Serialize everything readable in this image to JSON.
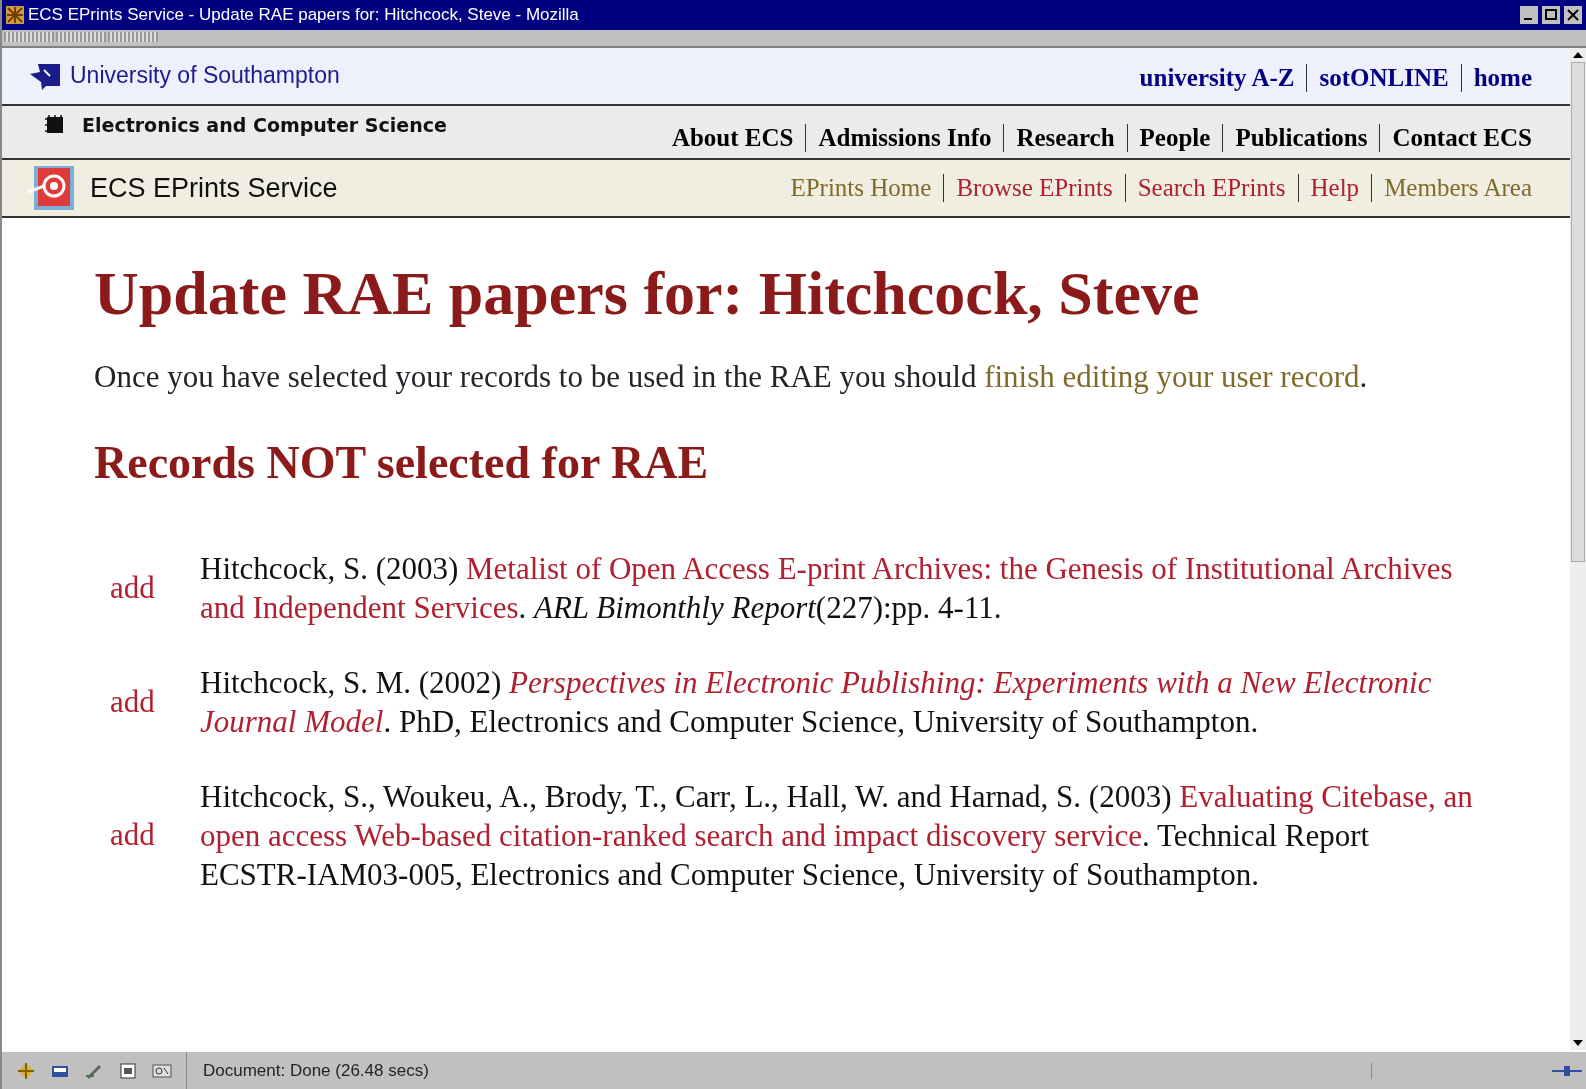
{
  "window": {
    "title": "ECS EPrints Service - Update RAE papers for: Hitchcock, Steve - Mozilla"
  },
  "university_bar": {
    "name": "University of Southampton",
    "links": [
      "university A-Z",
      "sotONLINE",
      "home"
    ]
  },
  "school_bar": {
    "name": "Electronics and Computer Science",
    "links": [
      "About ECS",
      "Admissions Info",
      "Research",
      "People",
      "Publications",
      "Contact ECS"
    ]
  },
  "eprints_bar": {
    "name": "ECS EPrints Service",
    "links": [
      {
        "label": "EPrints Home",
        "visited": true
      },
      {
        "label": "Browse EPrints",
        "visited": false
      },
      {
        "label": "Search EPrints",
        "visited": false
      },
      {
        "label": "Help",
        "visited": false
      },
      {
        "label": "Members Area",
        "visited": true
      }
    ]
  },
  "heading": "Update RAE papers for: Hitchcock, Steve",
  "intro": {
    "text": "Once you have selected your records to be used in the RAE you should",
    "link": "finish editing your user record",
    "after": "."
  },
  "section_heading": "Records NOT selected for RAE",
  "records": [
    {
      "action": "add",
      "parts": [
        {
          "kind": "plain",
          "text": "Hitchcock, S. (2003) "
        },
        {
          "kind": "link",
          "text": "Metalist of Open Access E-print Archives: the Genesis of Institutional Archives and Independent Services"
        },
        {
          "kind": "plain",
          "text": ". "
        },
        {
          "kind": "italic",
          "text": "ARL Bimonthly Report"
        },
        {
          "kind": "plain",
          "text": "(227):pp. 4-11."
        }
      ]
    },
    {
      "action": "add",
      "parts": [
        {
          "kind": "plain",
          "text": "Hitchcock, S. M. (2002) "
        },
        {
          "kind": "italic-link",
          "text": "Perspectives in Electronic Publishing: Experiments with a New Electronic Journal Model"
        },
        {
          "kind": "plain",
          "text": ". PhD, Electronics and Computer Science, University of Southampton."
        }
      ]
    },
    {
      "action": "add",
      "parts": [
        {
          "kind": "plain",
          "text": "Hitchcock, S., Woukeu, A., Brody, T., Carr, L., Hall, W. and Harnad, S. (2003) "
        },
        {
          "kind": "link",
          "text": "Evaluating Citebase, an open access Web-based citation-ranked search and impact discovery service"
        },
        {
          "kind": "plain",
          "text": ". Technical Report ECSTR-IAM03-005, Electronics and Computer Science, University of Southampton."
        }
      ]
    }
  ],
  "status_bar": {
    "text": "Document: Done (26.48 secs)"
  }
}
